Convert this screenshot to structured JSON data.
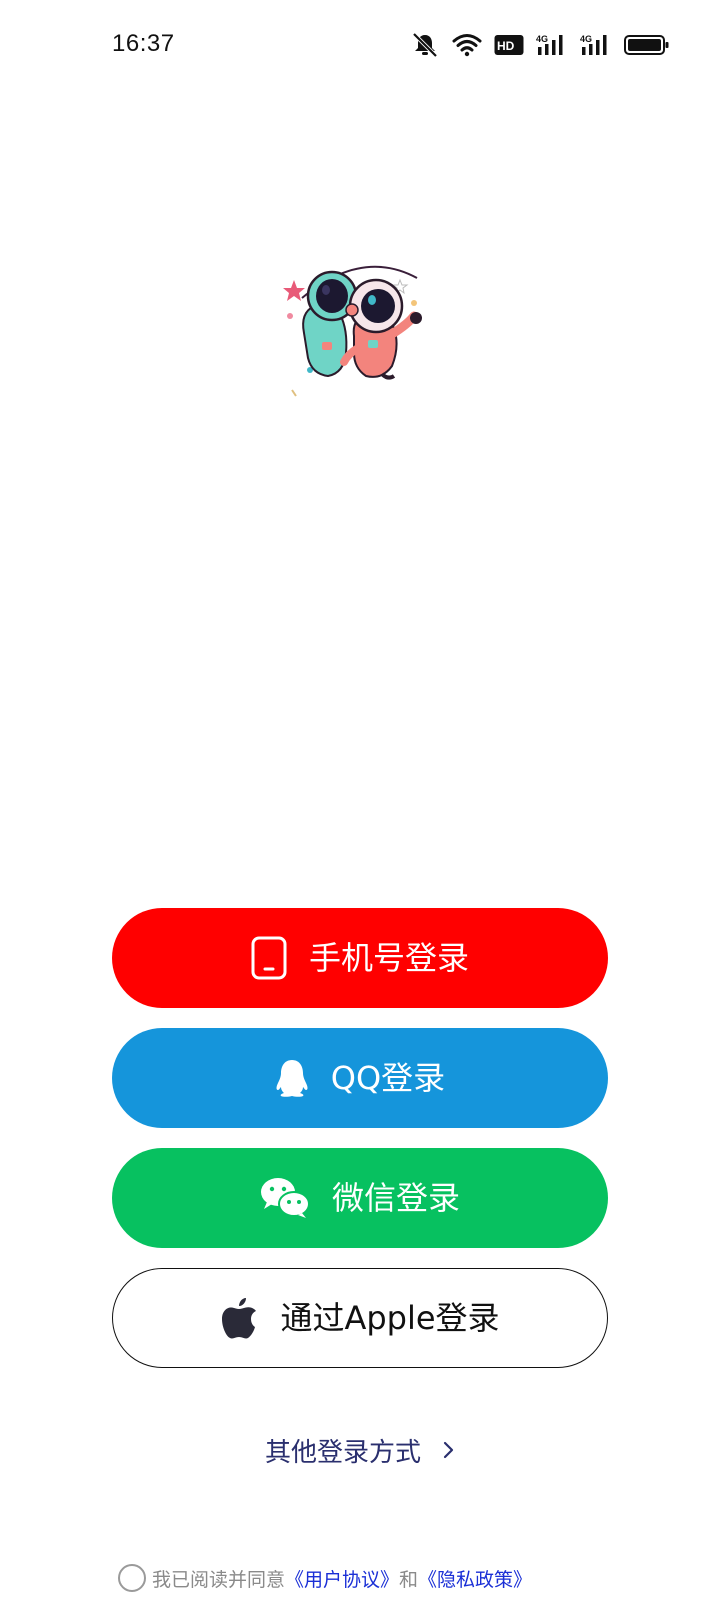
{
  "status_bar": {
    "time": "16:37",
    "icons": [
      "mute-bell-icon",
      "wifi-icon",
      "hd-icon",
      "signal-4g-icon",
      "signal-4g-icon",
      "battery-icon"
    ],
    "network_labels": [
      "HD",
      "4G",
      "4G"
    ]
  },
  "logo": {
    "icon": "astronaut-mascot-icon"
  },
  "login": {
    "phone": {
      "label": "手机号登录",
      "icon": "phone-icon",
      "color": "#ff0000"
    },
    "qq": {
      "label": "QQ登录",
      "icon": "qq-penguin-icon",
      "color": "#1595db"
    },
    "wechat": {
      "label": "微信登录",
      "icon": "wechat-icon",
      "color": "#07c160"
    },
    "apple": {
      "label": "通过Apple登录",
      "icon": "apple-icon",
      "color": "#ffffff"
    }
  },
  "other_methods": {
    "label": "其他登录方式",
    "icon": "chevron-right-icon"
  },
  "agreement": {
    "prefix": "我已阅读并同意",
    "user_agreement": "《用户协议》",
    "and": "和",
    "privacy_policy": "《隐私政策》",
    "checked": false
  }
}
